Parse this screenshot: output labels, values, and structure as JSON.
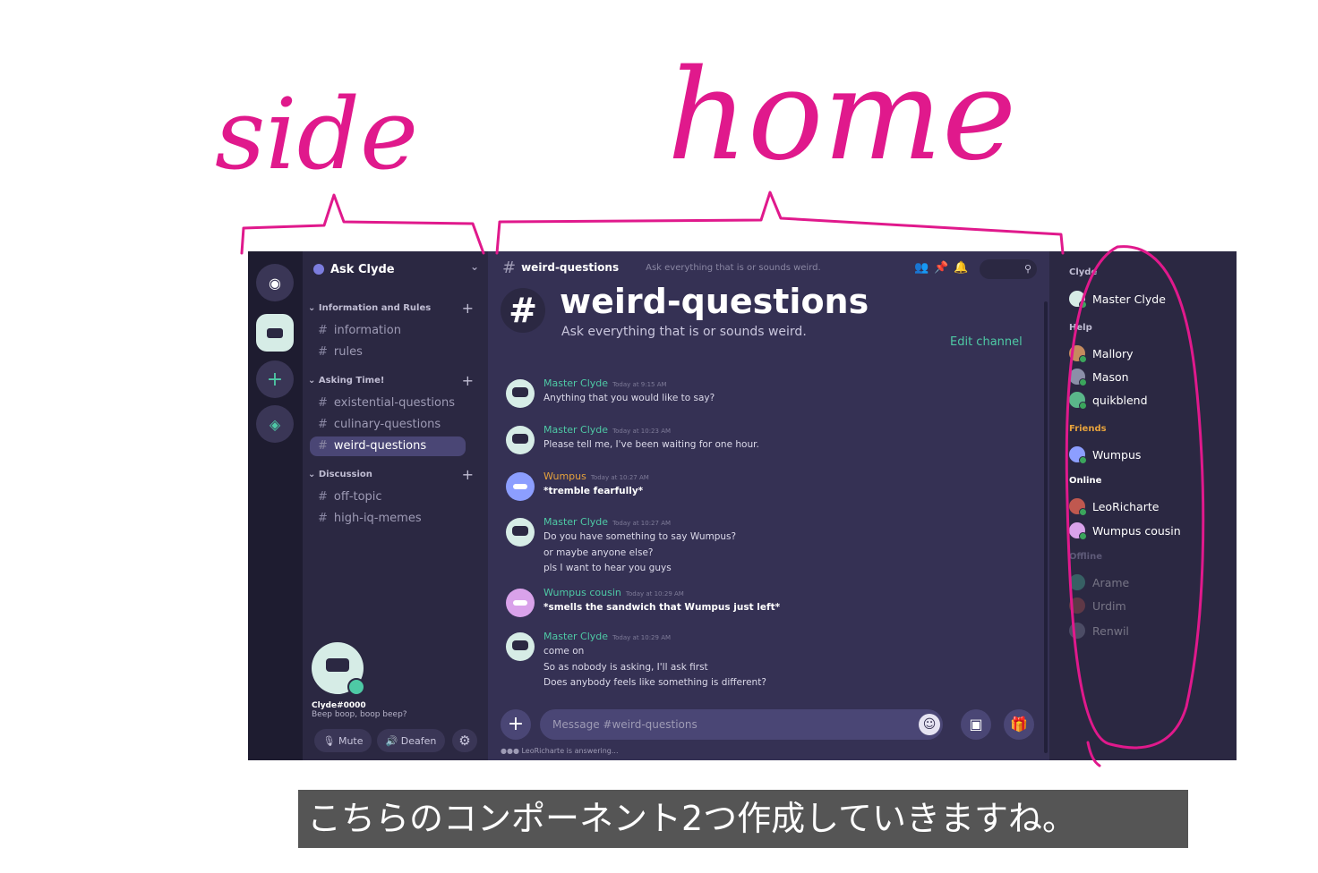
{
  "annotations": {
    "side": "side",
    "home": "home"
  },
  "colors": {
    "annotation": "#e0198c",
    "accent": "#4ec9a5",
    "bg_main": "#353154",
    "bg_sidebar": "#2b2842",
    "bg_rail": "#1e1c30"
  },
  "server_rail": {
    "icons": [
      "discord-logo-icon",
      "server-clyde-icon",
      "add-server-icon",
      "explore-icon"
    ]
  },
  "sidebar": {
    "server_name": "Ask Clyde",
    "categories": [
      {
        "name": "Information and Rules",
        "channels": [
          "information",
          "rules"
        ]
      },
      {
        "name": "Asking Time!",
        "channels": [
          "existential-questions",
          "culinary-questions",
          "weird-questions"
        ]
      },
      {
        "name": "Discussion",
        "channels": [
          "off-topic",
          "high-iq-memes"
        ]
      }
    ],
    "user": {
      "name": "Clyde#0000",
      "status": "Beep boop, boop beep?",
      "mute": "Mute",
      "deafen": "Deafen"
    }
  },
  "main": {
    "channel_name": "weird-questions",
    "topic": "Ask everything that is or sounds weird.",
    "edit_channel": "Edit channel",
    "messages": [
      {
        "author": "Master Clyde",
        "time": "Today at 9:15 AM",
        "lines": [
          "Anything that you would like to say?"
        ]
      },
      {
        "author": "Master Clyde",
        "time": "Today at 10:23 AM",
        "lines": [
          "Please tell me, I've been waiting for one hour."
        ]
      },
      {
        "author": "Wumpus",
        "time": "Today at 10:27 AM",
        "lines": [
          "*tremble fearfully*"
        ]
      },
      {
        "author": "Master Clyde",
        "time": "Today at 10:27 AM",
        "lines": [
          "Do you have something to say Wumpus?",
          "or maybe anyone else?",
          "pls I want to hear you guys"
        ]
      },
      {
        "author": "Wumpus cousin",
        "time": "Today at 10:29 AM",
        "lines": [
          "*smells the sandwich that Wumpus just left*"
        ]
      },
      {
        "author": "Master Clyde",
        "time": "Today at 10:29 AM",
        "lines": [
          "come on",
          "So as nobody is asking, I'll ask first",
          "Does anybody feels like something is different?"
        ]
      }
    ],
    "composer_placeholder": "Message #weird-questions",
    "typing_user": "LeoRicharte",
    "typing_suffix": "is answering..."
  },
  "members": {
    "groups": [
      {
        "name": "Clyde",
        "members": [
          "Master Clyde"
        ]
      },
      {
        "name": "Help",
        "members": [
          "Mallory",
          "Mason",
          "quikblend"
        ]
      },
      {
        "name": "Friends",
        "members": [
          "Wumpus"
        ]
      },
      {
        "name": "Online",
        "members": [
          "LeoRicharte",
          "Wumpus cousin"
        ]
      },
      {
        "name": "Offline",
        "members": [
          "Arame",
          "Urdim",
          "Renwil"
        ]
      }
    ]
  },
  "subtitle": "こちらのコンポーネント2つ作成していきますね。"
}
